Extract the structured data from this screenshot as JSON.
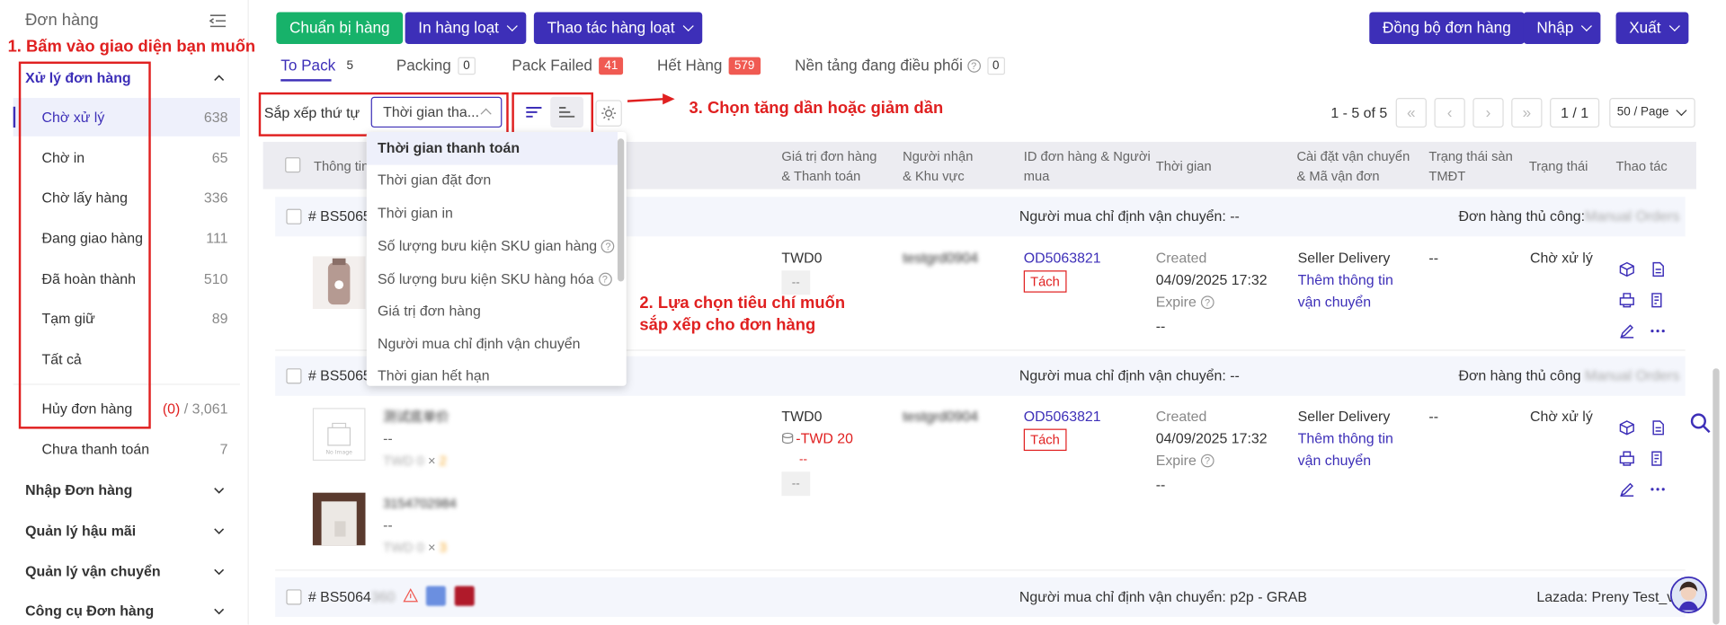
{
  "sidebar": {
    "title": "Đơn hàng",
    "group_active": "Xử lý đơn hàng",
    "items": [
      {
        "label": "Chờ xử lý",
        "count": "638"
      },
      {
        "label": "Chờ in",
        "count": "65"
      },
      {
        "label": "Chờ lấy hàng",
        "count": "336"
      },
      {
        "label": "Đang giao hàng",
        "count": "111"
      },
      {
        "label": "Đã hoàn thành",
        "count": "510"
      },
      {
        "label": "Tạm giữ",
        "count": "89"
      },
      {
        "label": "Tất cả",
        "count": ""
      }
    ],
    "cancel": {
      "label": "Hủy đơn hàng",
      "count_red": "(0)",
      "count_sep": "/",
      "count": "3,061"
    },
    "unpaid": {
      "label": "Chưa thanh toán",
      "count": "7"
    },
    "groups": [
      "Nhập Đơn hàng",
      "Quản lý hậu mãi",
      "Quản lý vận chuyển",
      "Công cụ Đơn hàng"
    ]
  },
  "toolbar": {
    "prepare": "Chuẩn bị hàng",
    "print_batch": "In hàng loạt",
    "batch_ops": "Thao tác hàng loạt",
    "sync": "Đồng bộ đơn hàng",
    "import": "Nhập",
    "export": "Xuất"
  },
  "tabs": [
    {
      "label": "To Pack",
      "count": "5"
    },
    {
      "label": "Packing",
      "count": "0"
    },
    {
      "label": "Pack Failed",
      "count": "41"
    },
    {
      "label": "Hết Hàng",
      "count": "579"
    },
    {
      "label": "Nền tảng đang điều phối",
      "count": "0"
    }
  ],
  "sort": {
    "label": "Sắp xếp thứ tự",
    "selected": "Thời gian tha...",
    "options": [
      "Thời gian thanh toán",
      "Thời gian đặt đơn",
      "Thời gian in",
      "Số lượng bưu kiện SKU gian hàng",
      "Số lượng bưu kiện SKU hàng hóa",
      "Giá trị đơn hàng",
      "Người mua chỉ định vận chuyển",
      "Thời gian hết hạn"
    ]
  },
  "annotations": {
    "a1": "1. Bấm vào giao diện bạn muốn",
    "a2_line1": "2. Lựa chọn tiêu chí muốn",
    "a2_line2": "sắp xếp cho đơn hàng",
    "a3": "3. Chọn tăng dần hoặc giảm dần"
  },
  "pager": {
    "range": "1 - 5 of 5",
    "page": "1 / 1",
    "page_size": "50 / Page"
  },
  "table_header": {
    "info": "Thông tin",
    "value": "Giá trị đơn hàng",
    "value2": "& Thanh toán",
    "receiver": "Người nhận",
    "receiver2": "& Khu vực",
    "order_id": "ID đơn hàng & Người",
    "order_id2": "mua",
    "time": "Thời gian",
    "shipping": "Cài đặt vận chuyển",
    "shipping2": "& Mã vận đơn",
    "platform_status": "Trạng thái sàn",
    "platform_status2": "TMĐT",
    "status": "Trạng thái",
    "actions": "Thao tác"
  },
  "orders": [
    {
      "no": "# BS5065",
      "buyer_ship": "Người mua chỉ định vận chuyển: --",
      "platform": "Đơn hàng thủ công:",
      "platform_blur": "Manual Orders",
      "value": "TWD0",
      "value_chip": "--",
      "receiver_blur": "testgrd0904",
      "order_id": "OD5063821",
      "split": "Tách",
      "created_label": "Created",
      "created": "04/09/2025 17:32",
      "expire": "Expire",
      "expire_val": "--",
      "ship_method": "Seller Delivery",
      "add_ship1": "Thêm thông tin",
      "add_ship2": "vận chuyển",
      "platform_status": "--",
      "status": "Chờ xử lý"
    },
    {
      "no": "# BS5065",
      "buyer_ship": "Người mua chỉ định vận chuyển: --",
      "platform": "Đơn hàng thủ công",
      "platform_blur": "Manual Orders",
      "value": "TWD0",
      "fee": "-TWD 20",
      "fee_sub": "--",
      "value_chip": "--",
      "receiver_blur": "testgrd0904",
      "order_id": "OD5063821",
      "split": "Tách",
      "created_label": "Created",
      "created": "04/09/2025 17:32",
      "expire": "Expire",
      "expire_val": "--",
      "ship_method": "Seller Delivery",
      "add_ship1": "Thêm thông tin",
      "add_ship2": "vận chuyển",
      "platform_status": "--",
      "status": "Chờ xử lý",
      "items": [
        {
          "name_blur": "测试底单价",
          "sub": "--",
          "price": "TWD 0",
          "x": "×",
          "qty": "2"
        },
        {
          "name_blur": "3154702984",
          "sub": "--",
          "price": "TWD 0",
          "x": "×",
          "qty": "3"
        }
      ]
    },
    {
      "no": "# BS5064",
      "no_blur": "360",
      "buyer_ship": "Người mua chỉ định vận chuyển: p2p - GRAB",
      "platform": "Lazada: Preny Test_vi"
    }
  ],
  "colors": {
    "brand": "#3d2fb8",
    "green": "#17b26a",
    "red": "#e02020"
  }
}
